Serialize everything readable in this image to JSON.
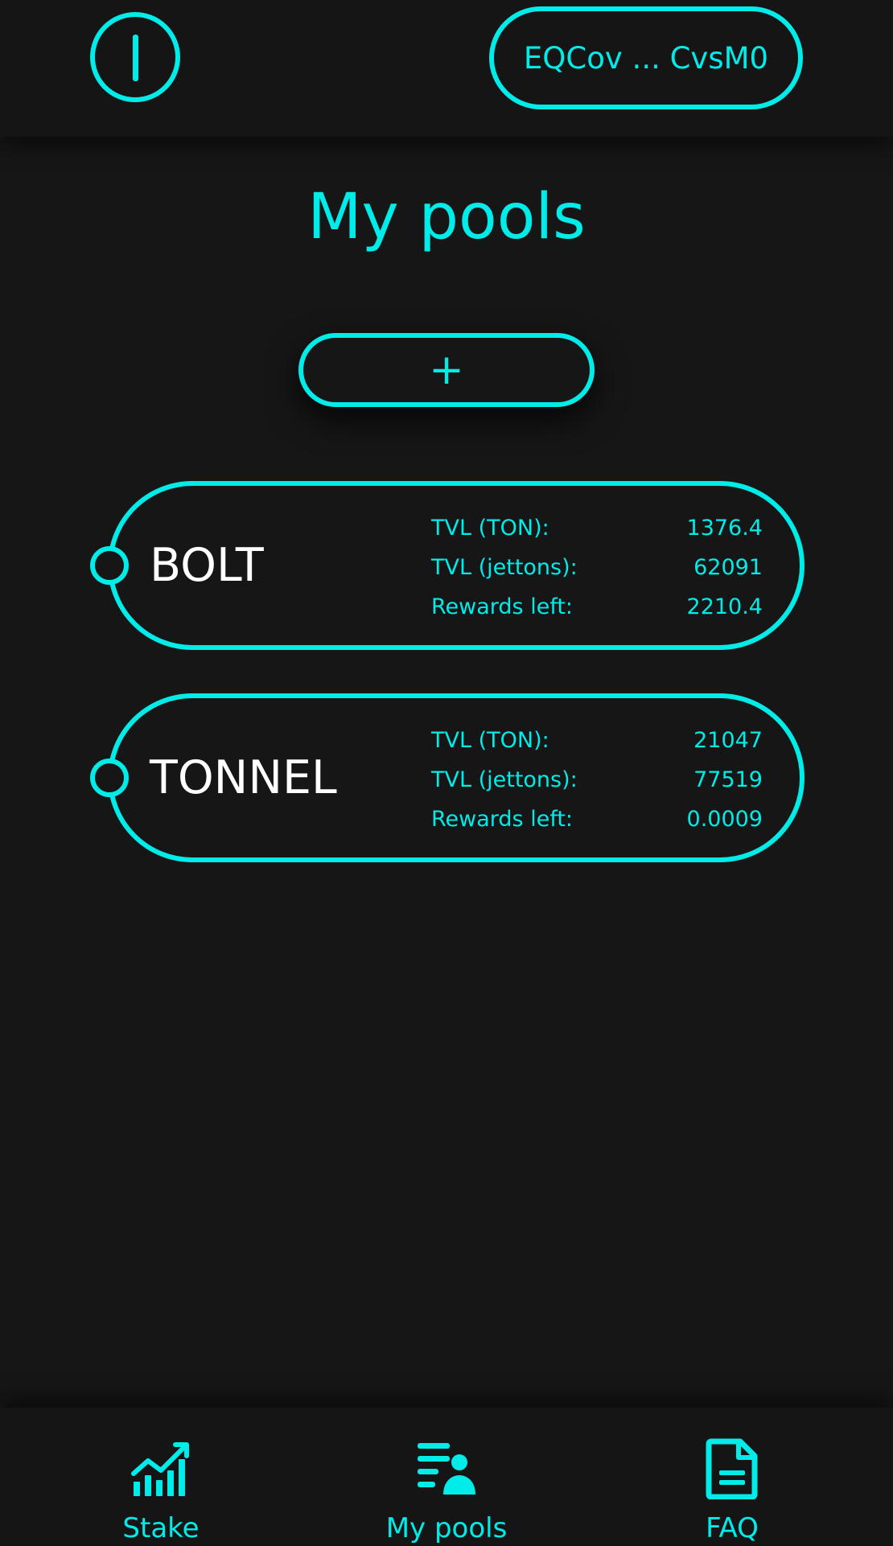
{
  "header": {
    "wallet_address": "EQCov ... CvsM0"
  },
  "page": {
    "title": "My pools",
    "add_label": "+"
  },
  "pools": [
    {
      "name": "BOLT",
      "stats": [
        {
          "label": "TVL (TON):",
          "value": "1376.4"
        },
        {
          "label": "TVL (jettons):",
          "value": "62091"
        },
        {
          "label": "Rewards left:",
          "value": "2210.4"
        }
      ]
    },
    {
      "name": "TONNEL",
      "stats": [
        {
          "label": "TVL (TON):",
          "value": "21047"
        },
        {
          "label": "TVL (jettons):",
          "value": "77519"
        },
        {
          "label": "Rewards left:",
          "value": "0.0009"
        }
      ]
    }
  ],
  "nav": {
    "items": [
      {
        "label": "Stake",
        "icon": "chart-icon"
      },
      {
        "label": "My pools",
        "icon": "user-list-icon"
      },
      {
        "label": "FAQ",
        "icon": "document-icon"
      }
    ]
  },
  "colors": {
    "accent": "#00ece9",
    "background": "#161616",
    "text": "#ffffff"
  }
}
